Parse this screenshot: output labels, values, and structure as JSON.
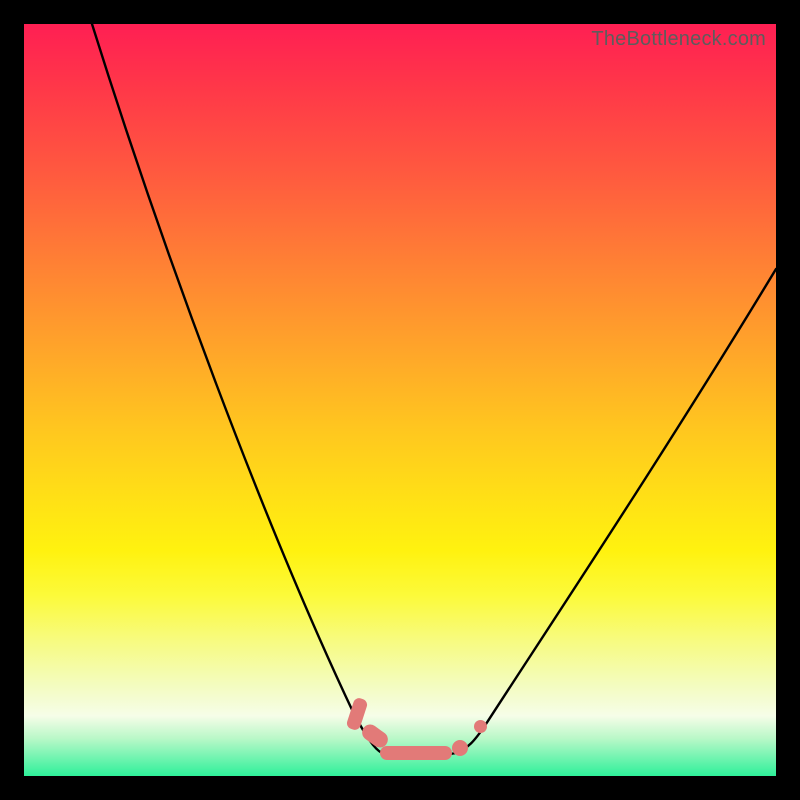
{
  "watermark": "TheBottleneck.com",
  "colors": {
    "curve_stroke": "#000000",
    "squiggle_fill": "#e27a78",
    "frame_bg": "#000000"
  },
  "chart_data": {
    "type": "line",
    "title": "",
    "xlabel": "",
    "ylabel": "",
    "xlim": [
      0,
      100
    ],
    "ylim": [
      0,
      100
    ],
    "grid": false,
    "legend": false,
    "annotations": [
      "TheBottleneck.com"
    ],
    "series": [
      {
        "name": "left-descent",
        "x": [
          9,
          14,
          18,
          22,
          26,
          30,
          34,
          38,
          41,
          43.5,
          45.5,
          47
        ],
        "values": [
          100,
          86,
          75,
          63,
          52,
          41,
          31,
          21,
          13,
          8,
          5,
          3
        ]
      },
      {
        "name": "trough",
        "x": [
          47,
          49,
          50.5,
          52,
          54,
          56,
          58
        ],
        "values": [
          3,
          2,
          2,
          2,
          2,
          2,
          3
        ]
      },
      {
        "name": "right-ascent",
        "x": [
          58,
          60,
          63,
          67,
          72,
          78,
          85,
          92,
          100
        ],
        "values": [
          3,
          5,
          8,
          13,
          20,
          29,
          40,
          52,
          67
        ]
      }
    ],
    "markers": [
      {
        "name": "left-vertical-blob",
        "x": 46,
        "y": 6,
        "shape": "rounded-vertical"
      },
      {
        "name": "left-diagonal-blob",
        "x": 48,
        "y": 3,
        "shape": "rounded-diagonal"
      },
      {
        "name": "flat-bottom-bar",
        "x": 52.5,
        "y": 2,
        "shape": "rounded-horizontal"
      },
      {
        "name": "right-small-blob-1",
        "x": 57.5,
        "y": 3,
        "shape": "round"
      },
      {
        "name": "right-small-blob-2",
        "x": 60,
        "y": 5.5,
        "shape": "round"
      }
    ]
  }
}
